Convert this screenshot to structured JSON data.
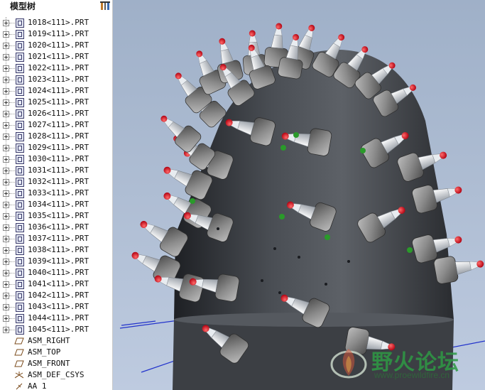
{
  "tree": {
    "title": "模型树",
    "tool_icon": "show-tree-settings-icon",
    "parts": [
      "1018<111>.PRT",
      "1019<111>.PRT",
      "1020<111>.PRT",
      "1021<111>.PRT",
      "1022<111>.PRT",
      "1023<111>.PRT",
      "1024<111>.PRT",
      "1025<111>.PRT",
      "1026<111>.PRT",
      "1027<111>.PRT",
      "1028<111>.PRT",
      "1029<111>.PRT",
      "1030<111>.PRT",
      "1031<111>.PRT",
      "1032<111>.PRT",
      "1033<111>.PRT",
      "1034<111>.PRT",
      "1035<111>.PRT",
      "1036<111>.PRT",
      "1037<111>.PRT",
      "1038<111>.PRT",
      "1039<111>.PRT",
      "1040<111>.PRT",
      "1041<111>.PRT",
      "1042<111>.PRT",
      "1043<111>.PRT",
      "1044<111>.PRT",
      "1045<111>.PRT"
    ],
    "datums": [
      {
        "label": "ASM_RIGHT",
        "icon": "datum-plane-icon"
      },
      {
        "label": "ASM_TOP",
        "icon": "datum-plane-icon"
      },
      {
        "label": "ASM_FRONT",
        "icon": "datum-plane-icon"
      },
      {
        "label": "ASM_DEF_CSYS",
        "icon": "coordinate-system-icon"
      },
      {
        "label": "AA_1",
        "icon": "datum-axis-icon"
      }
    ]
  },
  "watermark": {
    "chinese": "野火论坛",
    "url": "www.proewildfire.cn"
  },
  "colors": {
    "viewport_bg": "#adbcd2",
    "cone": "#3a3d42",
    "pick_tip": "#e0101a",
    "holder": "#8d8d8d",
    "axis_marker": "#2a9a2a",
    "datum_line": "#2233cc"
  }
}
